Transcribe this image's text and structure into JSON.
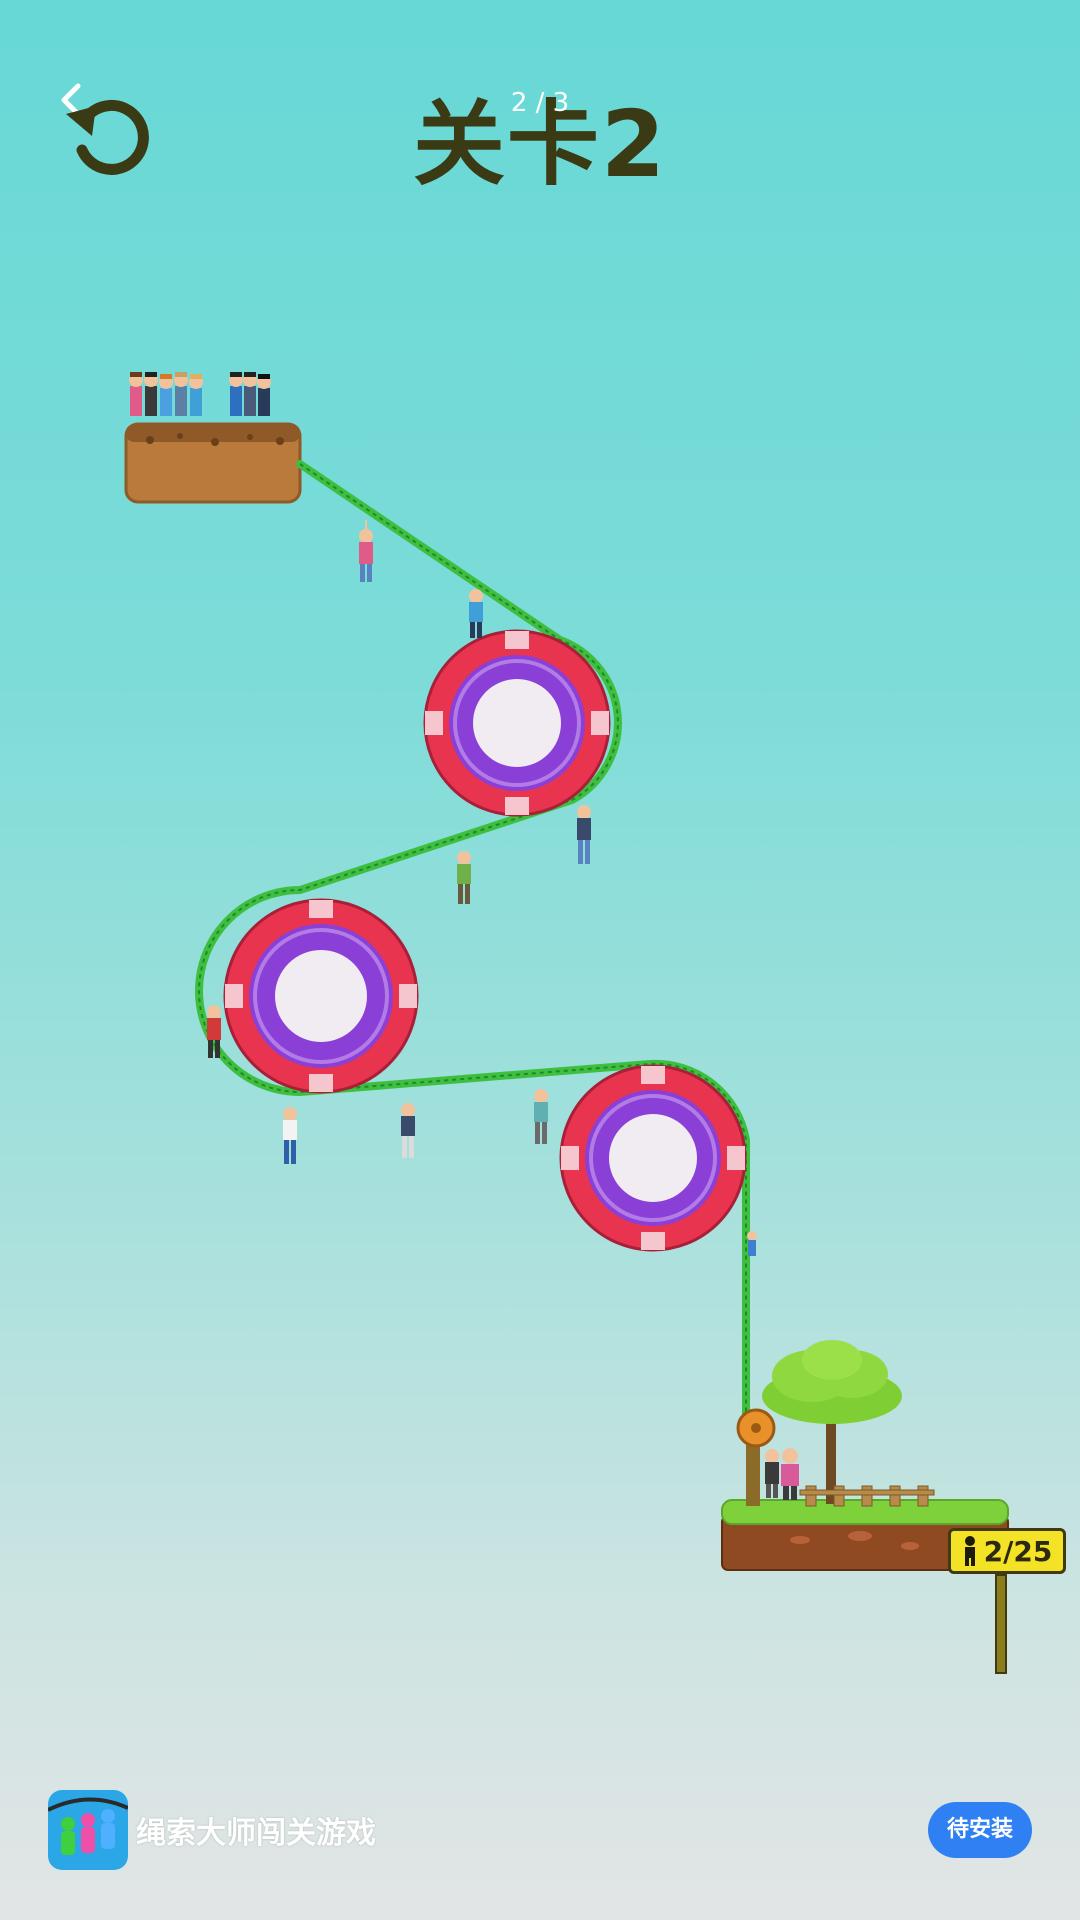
{
  "header": {
    "back_icon": "chevron-left-icon",
    "restart_icon": "restart-icon",
    "page_indicator": "2 / 3",
    "level_title": "关卡2"
  },
  "game": {
    "rescued_counter": "2/25",
    "counter_icon": "person-icon",
    "colors": {
      "rope": "#3fbf3f",
      "wheel_outer": "#e8344f",
      "wheel_inner": "#8a3fd6",
      "platform_dirt": "#b97a3c",
      "grass": "#7fd13b"
    }
  },
  "ad_banner": {
    "app_name": "绳索大师闯关游戏",
    "install_label": "待安装"
  }
}
